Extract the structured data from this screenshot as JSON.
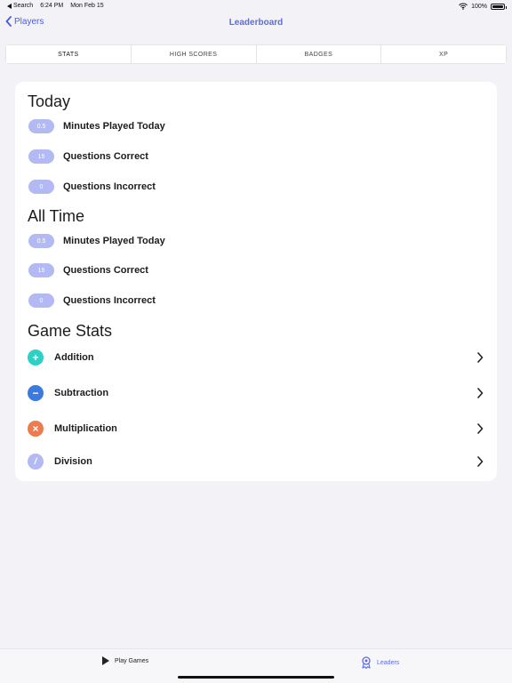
{
  "status_bar": {
    "back_app": "Search",
    "time": "6:24 PM",
    "date": "Mon Feb 15",
    "battery": "100%",
    "battery_level": 1.0
  },
  "nav": {
    "back_label": "Players",
    "title": "Leaderboard"
  },
  "segments": [
    {
      "label": "STATS",
      "selected": true
    },
    {
      "label": "HIGH SCORES",
      "selected": false
    },
    {
      "label": "BADGES",
      "selected": false
    },
    {
      "label": "XP",
      "selected": false
    }
  ],
  "today": {
    "title": "Today",
    "rows": [
      {
        "value": "0.5",
        "label": "Minutes Played Today"
      },
      {
        "value": "15",
        "label": "Questions Correct"
      },
      {
        "value": "0",
        "label": "Questions Incorrect"
      }
    ]
  },
  "all_time": {
    "title": "All Time",
    "rows": [
      {
        "value": "0.5",
        "label": "Minutes Played Today"
      },
      {
        "value": "15",
        "label": "Questions Correct"
      },
      {
        "value": "0",
        "label": "Questions Incorrect"
      }
    ]
  },
  "game_stats": {
    "title": "Game Stats",
    "games": [
      {
        "label": "Addition",
        "icon": "plus-icon",
        "symbol": "+",
        "color": "#2ad1c4"
      },
      {
        "label": "Subtraction",
        "icon": "minus-icon",
        "symbol": "−",
        "color": "#3b7be0"
      },
      {
        "label": "Multiplication",
        "icon": "times-icon",
        "symbol": "×",
        "color": "#ec7b4f"
      },
      {
        "label": "Division",
        "icon": "divide-icon",
        "symbol": "/",
        "color": "#b3baf3"
      }
    ]
  },
  "tab_bar": {
    "play_label": "Play Games",
    "leaders_label": "Leaders",
    "accent": "#5b6ae6"
  }
}
